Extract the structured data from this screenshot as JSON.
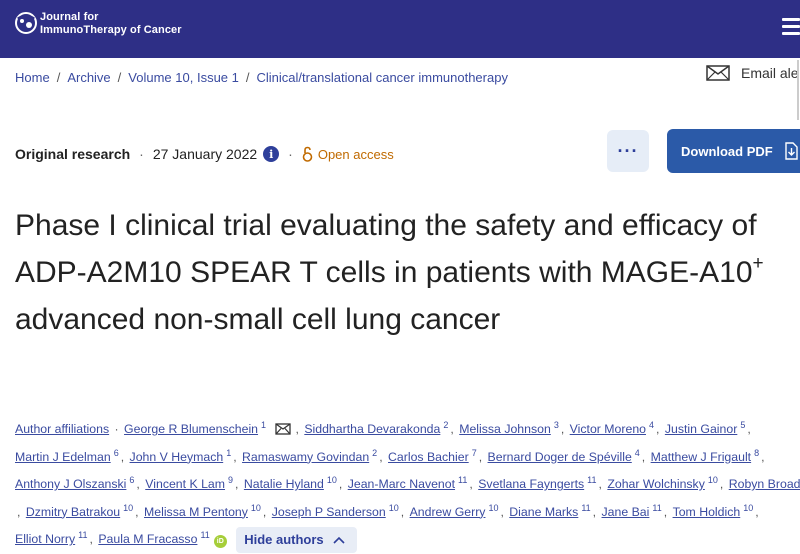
{
  "header": {
    "logo_line1": "Journal for",
    "logo_line2": "ImmunoTherapy of Cancer",
    "menu_icon": "hamburger-menu-icon"
  },
  "breadcrumb": [
    {
      "label": "Home"
    },
    {
      "label": "Archive"
    },
    {
      "label": "Volume 10, Issue 1"
    },
    {
      "label": "Clinical/translational cancer immunotherapy"
    }
  ],
  "email_alerts": {
    "label": "Email ale",
    "icon": "envelope-icon"
  },
  "article_meta": {
    "type": "Original research",
    "date": "27 January 2022",
    "info_icon_glyph": "i",
    "access": "Open access"
  },
  "actions": {
    "more_label": "···",
    "download_label": "Download PDF"
  },
  "title": {
    "part1": "Phase I clinical trial evaluating the safety and efficacy of ADP-A2M10 SPEAR T cells in patients with MAGE-A10",
    "superscript": "+",
    "part2": " advanced non-small cell lung cancer"
  },
  "authors": {
    "affiliations_label": "Author affiliations",
    "list": [
      {
        "name": "George R Blumenschein",
        "aff": "1"
      },
      {
        "name": "Siddhartha Devarakonda",
        "aff": "2"
      },
      {
        "name": "Melissa Johnson",
        "aff": "3"
      },
      {
        "name": "Victor Moreno",
        "aff": "4"
      },
      {
        "name": "Justin Gainor",
        "aff": "5"
      },
      {
        "name": "Martin J Edelman",
        "aff": "6"
      },
      {
        "name": "John V Heymach",
        "aff": "1"
      },
      {
        "name": "Ramaswamy Govindan",
        "aff": "2"
      },
      {
        "name": "Carlos Bachier",
        "aff": "7"
      },
      {
        "name": "Bernard Doger de Spéville",
        "aff": "4"
      },
      {
        "name": "Matthew J Frigault",
        "aff": "8"
      },
      {
        "name": "Anthony J Olszanski",
        "aff": "6"
      },
      {
        "name": "Vincent K Lam",
        "aff": "9"
      },
      {
        "name": "Natalie Hyland",
        "aff": "10"
      },
      {
        "name": "Jean-Marc Navenot",
        "aff": "11"
      },
      {
        "name": "Svetlana Fayngerts",
        "aff": "11"
      },
      {
        "name": "Zohar Wolchinsky",
        "aff": "10"
      },
      {
        "name": "Robyn Broad",
        "aff": ""
      },
      {
        "name": "Dzmitry Batrakou",
        "aff": "10"
      },
      {
        "name": "Melissa M Pentony",
        "aff": "10"
      },
      {
        "name": "Joseph P Sanderson",
        "aff": "10"
      },
      {
        "name": "Andrew Gerry",
        "aff": "10"
      },
      {
        "name": "Diane Marks",
        "aff": "11"
      },
      {
        "name": "Jane Bai",
        "aff": "11"
      },
      {
        "name": "Tom Holdich",
        "aff": "10"
      },
      {
        "name": "Elliot Norry",
        "aff": "11"
      },
      {
        "name": "Paula M Fracasso",
        "aff": "11"
      }
    ],
    "orcid_label": "iD",
    "hide_label": "Hide authors"
  },
  "colors": {
    "header_bg": "#2e2f86",
    "link": "#3a4ba0",
    "primary_button": "#2b5aa8",
    "open_access": "#c06a00",
    "orcid": "#a6ce39"
  }
}
